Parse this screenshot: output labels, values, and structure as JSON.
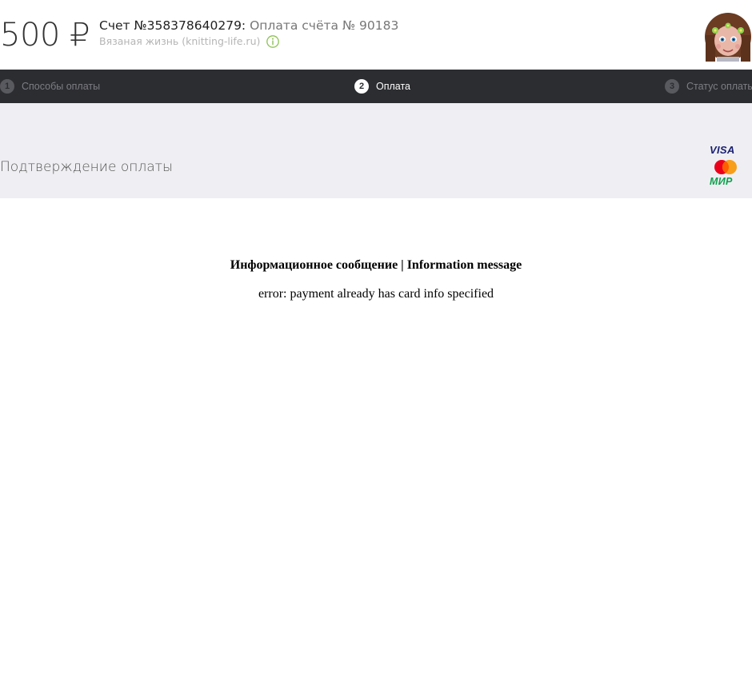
{
  "header": {
    "amount": "500 ₽",
    "invoice_number": "Счет №358378640279:",
    "invoice_purpose": "Оплата счёта № 90183",
    "merchant": "Вязаная жизнь (knitting-life.ru)",
    "info_icon": "info-icon",
    "avatar": "avatar"
  },
  "steps": [
    {
      "number": "1",
      "label": "Способы оплаты",
      "state": "inactive"
    },
    {
      "number": "2",
      "label": "Оплата",
      "state": "active"
    },
    {
      "number": "3",
      "label": "Статус оплаты",
      "state": "inactive"
    }
  ],
  "confirmation": {
    "title": "Подтверждение оплаты",
    "card_logos": {
      "visa": "VISA",
      "mastercard": "mastercard-logo",
      "mir": "МИР"
    }
  },
  "message": {
    "title": "Информационное сообщение | Information message",
    "text": "error: payment already has card info specified"
  },
  "colors": {
    "steps_bar": "#2c2d31",
    "band": "#efeff3",
    "info_icon": "#8cc152",
    "visa": "#1a1f71",
    "mir": "#0f9f4d",
    "mc_red": "#eb001b",
    "mc_orange": "#f79e1b"
  }
}
